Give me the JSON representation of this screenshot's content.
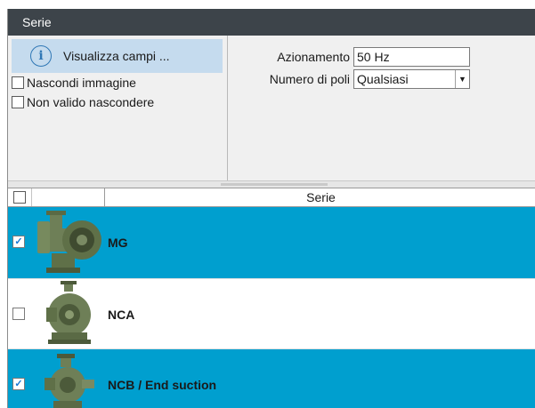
{
  "window": {
    "title": "Serie"
  },
  "filters": {
    "info_button_label": "Visualizza campi ...",
    "hide_image_label": "Nascondi immagine",
    "hide_invalid_label": "Non valido nascondere",
    "drive_label": "Azionamento",
    "drive_value": "50 Hz",
    "poles_label": "Numero di poli",
    "poles_value": "Qualsiasi"
  },
  "grid": {
    "header_series": "Serie",
    "rows": [
      {
        "name": "MG",
        "checked": true
      },
      {
        "name": "NCA",
        "checked": false
      },
      {
        "name": "NCB / End suction",
        "checked": true
      }
    ]
  },
  "colors": {
    "title_bar": "#3d444a",
    "selected_row": "#009fcf",
    "info_button": "#c5dbee",
    "pump_body": "#6e7f57"
  },
  "icons": {
    "info": "info-circle-icon",
    "dropdown": "chevron-down-icon",
    "check": "checkmark-icon"
  }
}
